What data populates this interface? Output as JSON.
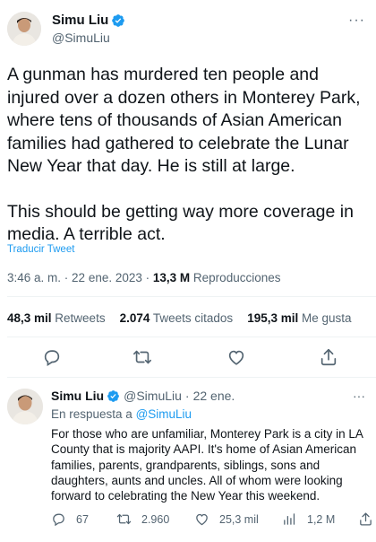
{
  "tweet": {
    "author_name": "Simu Liu",
    "author_handle": "@SimuLiu",
    "more_label": "···",
    "paragraph_1": "A gunman has murdered ten people and injured over a dozen others in Monterey Park, where tens of thousands of Asian American families had gathered to celebrate the Lunar New Year that day. He is still at large.",
    "paragraph_2": "This should be getting way more coverage in media. A terrible act.",
    "translate_label": "Traducir Tweet",
    "time": "3:46 a. m.",
    "separator": " · ",
    "date": "22 ene. 2023",
    "views_count": "13,3 M",
    "views_label": "Reproducciones",
    "retweets_count": "48,3 mil",
    "retweets_label": "Retweets",
    "quotes_count": "2.074",
    "quotes_label": "Tweets citados",
    "likes_count": "195,3 mil",
    "likes_label": "Me gusta"
  },
  "reply": {
    "author_name": "Simu Liu",
    "author_handle": "@SimuLiu",
    "dot": "·",
    "date": "22 ene.",
    "more_label": "···",
    "reply_to_prefix": "En respuesta a",
    "reply_to_handle": "@SimuLiu",
    "text": "For those who are unfamiliar, Monterey Park is a city in LA County that is majority AAPI. It's home of Asian American families, parents, grandparents, siblings, sons and daughters, aunts and uncles. All of whom were looking forward to celebrating the New Year this weekend.",
    "replies": "67",
    "retweets": "2.960",
    "likes": "25,3 mil",
    "views": "1,2 M"
  },
  "colors": {
    "accent": "#1d9bf0",
    "secondary_text": "#536471",
    "primary_text": "#0f1419",
    "divider": "#eff3f4"
  },
  "icons": [
    "verified-badge-icon",
    "reply-icon",
    "retweet-icon",
    "like-icon",
    "share-icon",
    "views-icon",
    "more-icon"
  ]
}
